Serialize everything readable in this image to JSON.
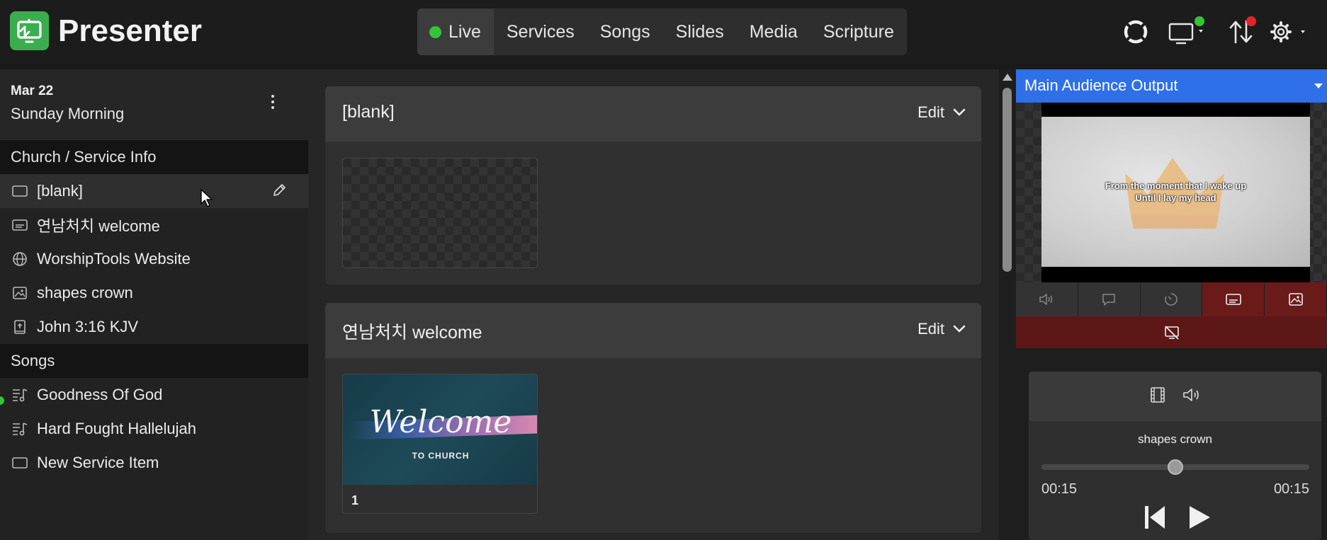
{
  "app": {
    "name": "Presenter",
    "brand_color": "#3aae4f"
  },
  "nav": {
    "tabs": [
      {
        "label": "Live",
        "active": true
      },
      {
        "label": "Services"
      },
      {
        "label": "Songs"
      },
      {
        "label": "Slides"
      },
      {
        "label": "Media"
      },
      {
        "label": "Scripture"
      }
    ],
    "live_color": "#36c33a"
  },
  "top_icons": [
    "sync-icon",
    "display-icon",
    "transfer-icon",
    "gear-icon"
  ],
  "service": {
    "date": "Mar 22",
    "name": "Sunday Morning"
  },
  "sidebar": {
    "section_info": "Church / Service Info",
    "info_items": [
      {
        "label": "[blank]",
        "icon": "blank-slide-icon",
        "selected": true
      },
      {
        "label": "연남처치 welcome",
        "icon": "caption-slide-icon"
      },
      {
        "label": "WorshipTools Website",
        "icon": "globe-icon"
      },
      {
        "label": "shapes crown",
        "icon": "image-icon"
      },
      {
        "label": "John 3:16 KJV",
        "icon": "bible-icon"
      }
    ],
    "section_songs": "Songs",
    "song_items": [
      {
        "label": "Goodness Of God",
        "icon": "song-icon",
        "live": true
      },
      {
        "label": "Hard Fought Hallelujah",
        "icon": "song-icon"
      },
      {
        "label": "New Service Item",
        "icon": "blank-slide-icon"
      }
    ]
  },
  "cards": [
    {
      "title": "[blank]",
      "edit": "Edit"
    },
    {
      "title": "연남처치 welcome",
      "edit": "Edit",
      "slide": {
        "number": "1",
        "text_main": "Welcome",
        "text_sub": "TO CHURCH"
      }
    }
  ],
  "output": {
    "title": "Main Audience Output",
    "accent": "#2f6fe8",
    "lyrics": [
      "From the moment that I wake up",
      "Until I lay my head"
    ],
    "controls": [
      "volume-icon",
      "message-icon",
      "timer-icon",
      "caption-icon",
      "image-icon"
    ],
    "active_control": "caption-icon",
    "clear_icon": "clear-display-icon"
  },
  "media": {
    "name": "shapes crown",
    "progress": 0.5,
    "time_elapsed": "00:15",
    "time_total": "00:15"
  }
}
